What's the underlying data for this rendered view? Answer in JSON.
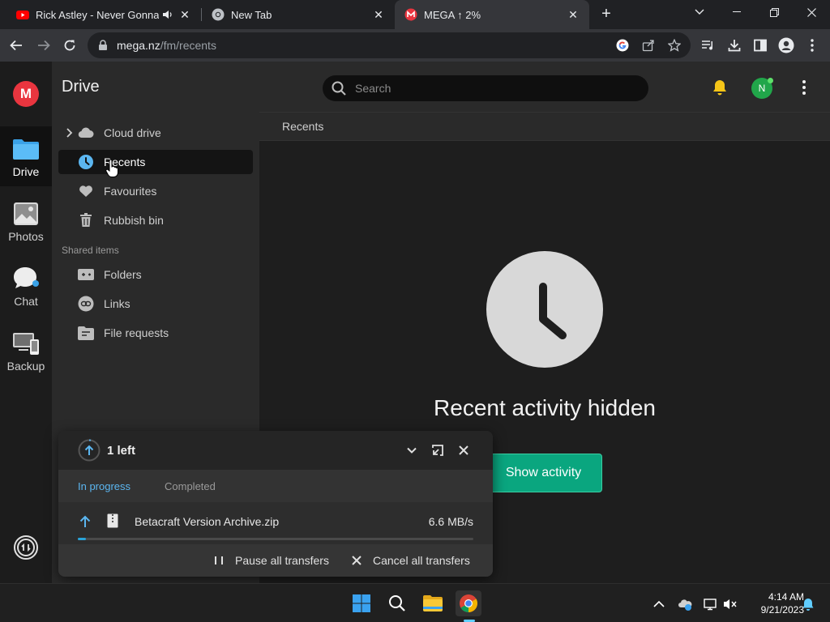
{
  "browser": {
    "tabs": [
      {
        "title": "Rick Astley - Never Gonna Gi",
        "favicon": "youtube-icon"
      },
      {
        "title": "New Tab",
        "favicon": "chrome-icon"
      },
      {
        "title": "MEGA ↑ 2%",
        "favicon": "mega-icon"
      }
    ],
    "url_host": "mega.nz",
    "url_path": "/fm/recents"
  },
  "rail": {
    "logo": "M",
    "items": [
      {
        "label": "Drive"
      },
      {
        "label": "Photos"
      },
      {
        "label": "Chat"
      },
      {
        "label": "Backup"
      }
    ]
  },
  "sidebar": {
    "title": "Drive",
    "items": [
      {
        "label": "Cloud drive"
      },
      {
        "label": "Recents"
      },
      {
        "label": "Favourites"
      },
      {
        "label": "Rubbish bin"
      }
    ],
    "section": "Shared items",
    "shared": [
      {
        "label": "Folders"
      },
      {
        "label": "Links"
      },
      {
        "label": "File requests"
      }
    ]
  },
  "topbar": {
    "search_placeholder": "Search",
    "avatar_initial": "N"
  },
  "breadcrumb": "Recents",
  "empty": {
    "title": "Recent activity hidden",
    "button": "Show activity"
  },
  "transfers": {
    "count": "1 left",
    "tabs": [
      "In progress",
      "Completed"
    ],
    "items": [
      {
        "name": "Betacraft Version Archive.zip",
        "speed": "6.6 MB/s",
        "progress": 0.02
      }
    ],
    "pause": "Pause all transfers",
    "cancel": "Cancel all transfers"
  },
  "taskbar": {
    "time": "4:14 AM",
    "date": "9/21/2023"
  },
  "colors": {
    "accent_green": "#0aa67f",
    "mega_red": "#e9353f",
    "progress_blue": "#29a3d8"
  }
}
